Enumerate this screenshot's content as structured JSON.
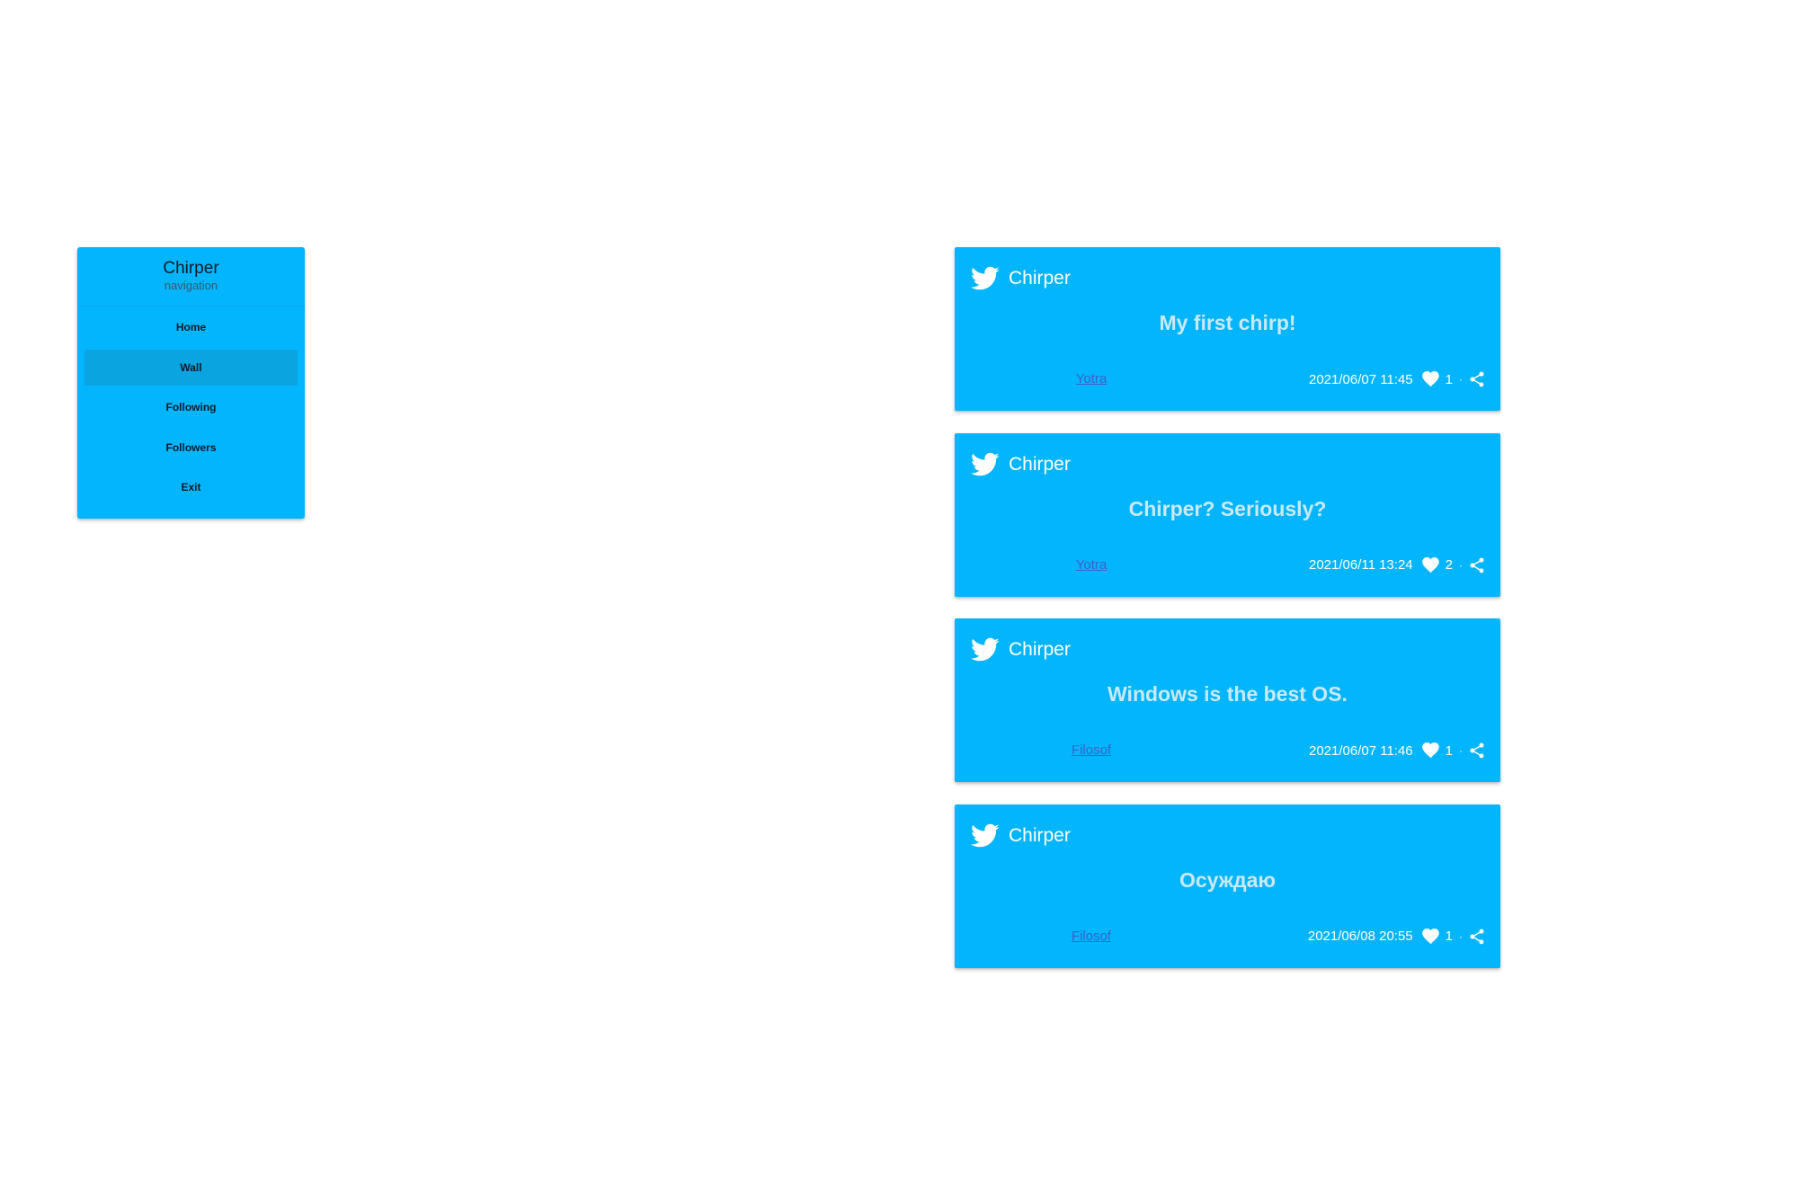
{
  "sidebar": {
    "title": "Chirper",
    "subtitle": "navigation",
    "items": [
      {
        "label": "Home"
      },
      {
        "label": "Wall"
      },
      {
        "label": "Following"
      },
      {
        "label": "Followers"
      },
      {
        "label": "Exit"
      }
    ],
    "active_item": "Wall"
  },
  "feed": {
    "chirps": [
      {
        "brand": "Chirper",
        "text": "My first chirp!",
        "author": "Yotra",
        "timestamp": "2021/06/07 11:45",
        "likes": "1",
        "separator": "·"
      },
      {
        "brand": "Chirper",
        "text": "Chirper? Seriously?",
        "author": "Yotra",
        "timestamp": "2021/06/11 13:24",
        "likes": "2",
        "separator": "·"
      },
      {
        "brand": "Chirper",
        "text": "Windows is the best OS.",
        "author": "Filosof",
        "timestamp": "2021/06/07 11:46",
        "likes": "1",
        "separator": "·"
      },
      {
        "brand": "Chirper",
        "text": "Осуждаю",
        "author": "Filosof",
        "timestamp": "2021/06/08 20:55",
        "likes": "1",
        "separator": "·"
      }
    ]
  },
  "icons": {
    "brand": "bird-icon",
    "like": "heart-icon",
    "share": "share-icon"
  },
  "colors": {
    "card_background": "#03b5fc",
    "active_nav_background": "#0aa4e0",
    "chirp_text": "#c8e9f8",
    "author_link": "#3a63c9"
  }
}
